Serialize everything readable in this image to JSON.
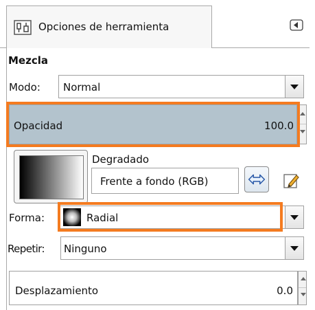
{
  "tab": {
    "label": "Opciones de herramienta"
  },
  "section": {
    "title": "Mezcla"
  },
  "mode": {
    "label": "Modo:",
    "value": "Normal"
  },
  "opacity": {
    "label": "Opacidad",
    "value": "100.0"
  },
  "gradient": {
    "label": "Degradado",
    "value": "Frente a fondo (RGB)"
  },
  "shape": {
    "label": "Forma:",
    "value": "Radial"
  },
  "repeat": {
    "label": "Repetir:",
    "value": "Ninguno"
  },
  "offset": {
    "label": "Desplazamiento",
    "value": "0.0"
  },
  "colors": {
    "highlight": "#f47b20",
    "slider_fill": "#b3c3cd"
  }
}
